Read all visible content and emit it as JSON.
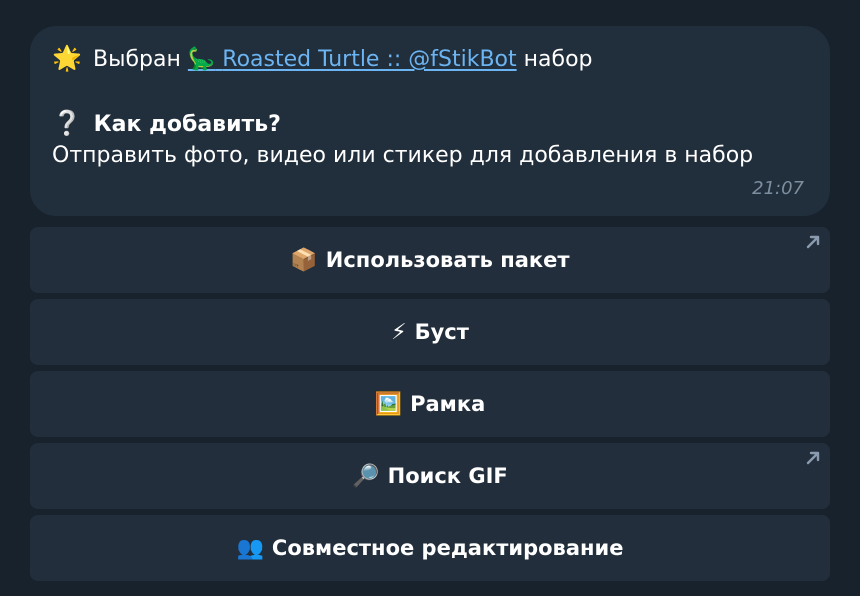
{
  "message": {
    "line1": {
      "emoji": "🌟",
      "prefix": "Выбран",
      "link_emoji": "🦕",
      "link_text": "Roasted Turtle :: @fStikBot",
      "suffix": "набор"
    },
    "line2": {
      "emoji": "❔",
      "text": "Как добавить?"
    },
    "line3": "Отправить фото, видео или стикер для добавления в набор",
    "time": "21:07"
  },
  "keyboard": [
    {
      "emoji": "📦",
      "label": "Использовать пакет",
      "has_arrow": true
    },
    {
      "emoji": "⚡",
      "label": "Буст",
      "has_arrow": false
    },
    {
      "emoji": "🖼️",
      "label": "Рамка",
      "has_arrow": false
    },
    {
      "emoji": "🔎",
      "label": "Поиск GIF",
      "has_arrow": true
    },
    {
      "emoji": "👥",
      "label": "Совместное редактирование",
      "has_arrow": false
    }
  ],
  "colors": {
    "background": "#18222d",
    "bubble": "#212e3b",
    "link": "#6cb4f2",
    "time": "#7d8e9f",
    "button": "#222e3b",
    "arrow": "#8a9bb0"
  }
}
